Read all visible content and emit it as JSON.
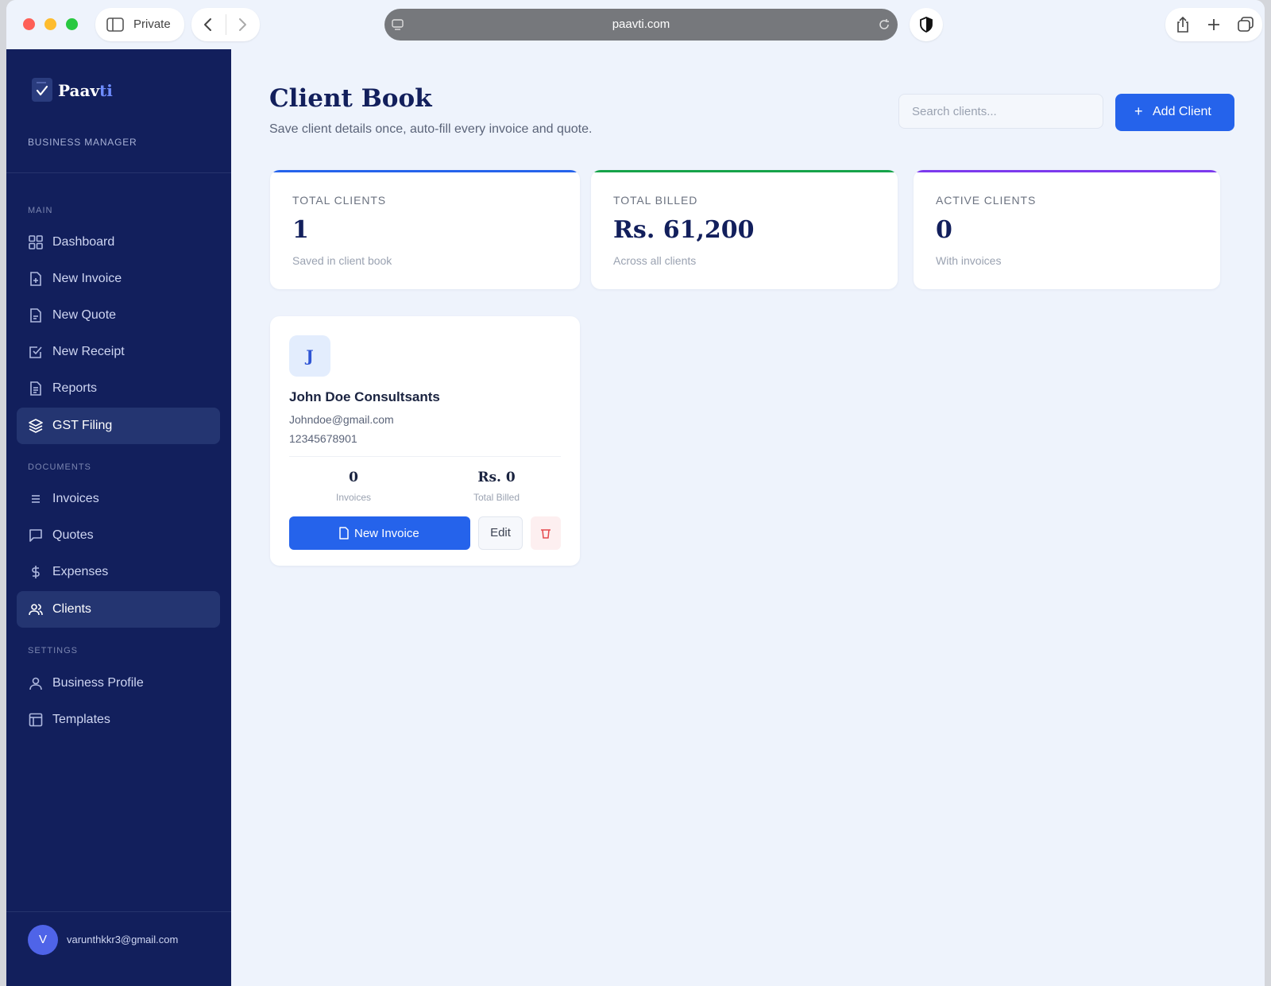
{
  "browser": {
    "private_label": "Private",
    "url": "paavti.com"
  },
  "sidebar": {
    "brand_prefix": "Paav",
    "brand_suffix": "ti",
    "brand_subtitle": "BUSINESS MANAGER",
    "sections": {
      "main": "MAIN",
      "documents": "DOCUMENTS",
      "settings": "SETTINGS"
    },
    "items": [
      {
        "label": "Dashboard",
        "icon": "grid-icon"
      },
      {
        "label": "New Invoice",
        "icon": "file-plus-icon"
      },
      {
        "label": "New Quote",
        "icon": "file-icon"
      },
      {
        "label": "New Receipt",
        "icon": "check-square-icon"
      },
      {
        "label": "Reports",
        "icon": "file-text-icon"
      },
      {
        "label": "GST Filing",
        "icon": "layers-icon"
      },
      {
        "label": "Invoices",
        "icon": "list-icon"
      },
      {
        "label": "Quotes",
        "icon": "message-square-icon"
      },
      {
        "label": "Expenses",
        "icon": "dollar-icon"
      },
      {
        "label": "Clients",
        "icon": "users-icon"
      },
      {
        "label": "Business Profile",
        "icon": "user-icon"
      },
      {
        "label": "Templates",
        "icon": "layout-icon"
      }
    ],
    "user": {
      "initial": "V",
      "email": "varunthkkr3@gmail.com"
    }
  },
  "header": {
    "title": "Client Book",
    "subtitle": "Save client details once, auto-fill every invoice and quote.",
    "search_placeholder": "Search clients...",
    "add_button": "Add Client"
  },
  "stats": [
    {
      "label": "TOTAL CLIENTS",
      "value": "1",
      "sub": "Saved in client book",
      "color": "#2563eb"
    },
    {
      "label": "TOTAL BILLED",
      "value": "Rs. 61,200",
      "sub": "Across all clients",
      "color": "#16a34a"
    },
    {
      "label": "ACTIVE CLIENTS",
      "value": "0",
      "sub": "With invoices",
      "color": "#7c3aed"
    }
  ],
  "client": {
    "initial": "J",
    "name": "John Doe Consultsants",
    "email": "Johndoe@gmail.com",
    "phone": "12345678901",
    "invoices_value": "0",
    "invoices_label": "Invoices",
    "billed_value": "Rs. 0",
    "billed_label": "Total Billed",
    "new_invoice_label": "New Invoice",
    "edit_label": "Edit"
  },
  "colors": {
    "sidebar_bg": "#121f5c",
    "accent": "#2563eb",
    "page_bg": "#eef3fc"
  }
}
